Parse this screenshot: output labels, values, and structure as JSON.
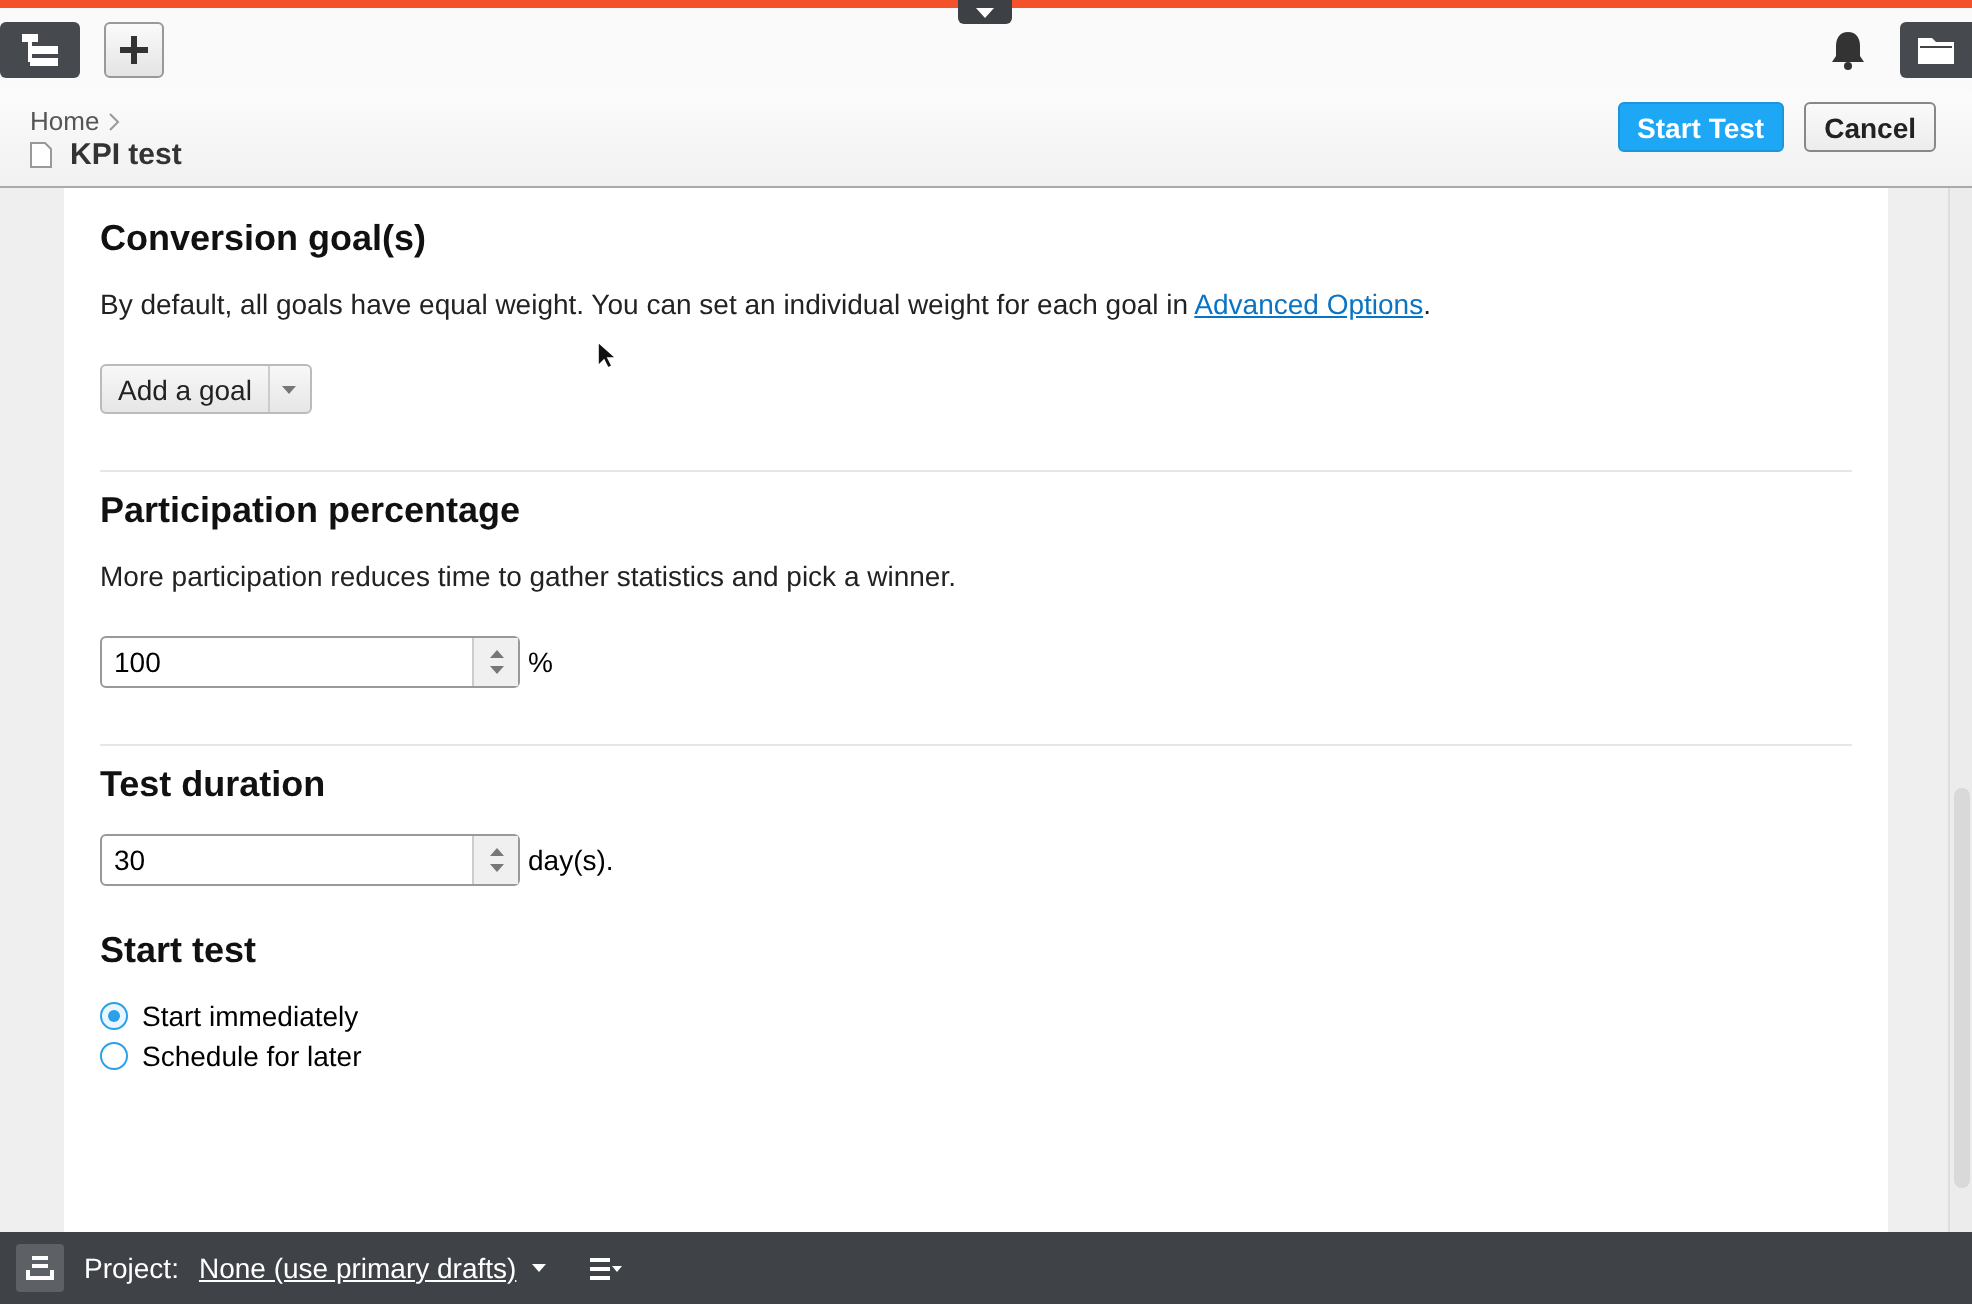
{
  "header": {
    "breadcrumb": "Home",
    "page_title": "KPI test",
    "buttons": [
      {
        "label": "Start Test",
        "kind": "primary"
      },
      {
        "label": "Cancel",
        "kind": "secondary"
      }
    ]
  },
  "sections": [
    {
      "kind": "goals",
      "title": "Conversion goal(s)",
      "description": "By default, all goals have equal weight. You can set an individual weight for each goal in ",
      "link": "Advanced Options",
      "link_after": ".",
      "dropdown": "Add a goal"
    },
    {
      "kind": "number",
      "title": "Participation percentage",
      "description": "More participation reduces time to gather statistics and pick a winner.",
      "value": "100",
      "unit": "%"
    },
    {
      "kind": "number",
      "title": "Test duration",
      "value": "30",
      "unit": "day(s)."
    },
    {
      "kind": "radio",
      "title": "Start test",
      "options": [
        {
          "label": "Start immediately",
          "selected": true
        },
        {
          "label": "Schedule for later",
          "selected": false
        }
      ]
    }
  ],
  "status_bar": {
    "label": "Project:",
    "project": "None (use primary drafts)"
  }
}
